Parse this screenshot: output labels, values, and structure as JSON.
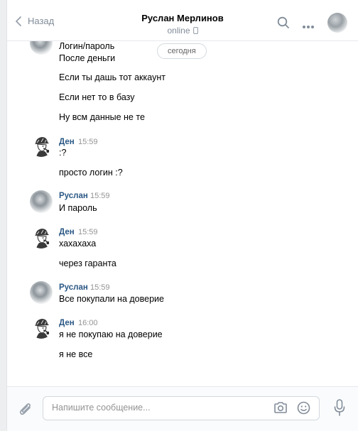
{
  "header": {
    "back_label": "Назад",
    "title": "Руслан Мерлинов",
    "status": "online"
  },
  "date_separator": "сегодня",
  "messages": [
    {
      "author": "",
      "time": "",
      "avatar": "ruslan",
      "lines": [
        "Логин/пароль",
        "После деньги",
        "Если ты дашь тот аккаунт",
        "Если нет то в базу",
        "Ну всм данные не те"
      ]
    },
    {
      "author": "Ден",
      "time": "15:59",
      "avatar": "den",
      "lines": [
        ":?",
        "просто логин :?"
      ]
    },
    {
      "author": "Руслан",
      "time": "15:59",
      "avatar": "ruslan",
      "lines": [
        "И пароль"
      ]
    },
    {
      "author": "Ден",
      "time": "15:59",
      "avatar": "den",
      "lines": [
        "хахахаха",
        "через гаранта"
      ]
    },
    {
      "author": "Руслан",
      "time": "15:59",
      "avatar": "ruslan",
      "lines": [
        "Все покупали на доверие"
      ]
    },
    {
      "author": "Ден",
      "time": "16:00",
      "avatar": "den",
      "lines": [
        "я не покупаю на доверие",
        "я не все"
      ]
    }
  ],
  "composer": {
    "placeholder": "Напишите сообщение..."
  },
  "icons": {
    "back": "chevron-left-icon",
    "search": "search-icon",
    "more": "more-dots-icon",
    "phone": "mobile-phone-icon",
    "attach": "paperclip-icon",
    "camera": "camera-icon",
    "emoji": "smile-icon",
    "mic": "microphone-icon"
  },
  "colors": {
    "author_name": "#2a5885",
    "muted": "#818c99",
    "accent": "#5181b8"
  }
}
